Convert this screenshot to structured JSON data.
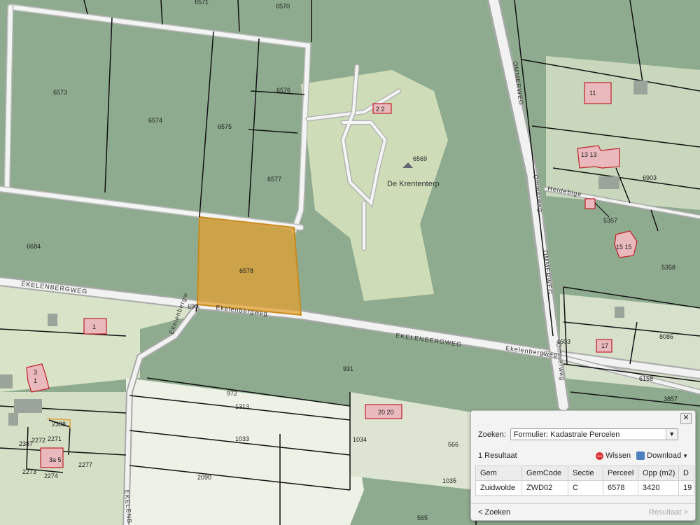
{
  "map": {
    "parcels": [
      "6571",
      "6570",
      "6573",
      "6574",
      "6575",
      "6576",
      "6577",
      "6569",
      "6684",
      "6578",
      "690",
      "931",
      "972",
      "1313",
      "1033",
      "1034",
      "2090",
      "2388",
      "2387",
      "2272",
      "2271",
      "2273",
      "2274",
      "2277",
      "566",
      "1035",
      "565",
      "6903",
      "5357",
      "5358",
      "4603",
      "8086",
      "6158",
      "3857"
    ],
    "houses": [
      "2 2",
      "11",
      "13 13",
      "15 15",
      "17",
      "1",
      "3",
      "20 20",
      "1",
      "3a 5"
    ],
    "place_name": "De Krententerp",
    "roads": [
      "OMMERWEG",
      "Ommerweg",
      "OMMERWEG",
      "Ommerweg",
      "EKELENBERGWEG",
      "Ekelenbergweg",
      "EKELENBERGWEG",
      "Ekelenbergweg",
      "Ekelenbergw",
      "EKELENB",
      "Heidebige"
    ],
    "highlight_color": "#e0a030"
  },
  "panel": {
    "search_label": "Zoeken:",
    "search_value": "Formulier: Kadastrale Percelen",
    "result_count": "1 Resultaat",
    "wissen_label": "Wissen",
    "download_label": "Download",
    "columns": [
      "Gem",
      "GemCode",
      "Sectie",
      "Perceel",
      "Opp (m2)",
      "D"
    ],
    "row": [
      "Zuidwolde",
      "ZWD02",
      "C",
      "6578",
      "3420",
      "19"
    ],
    "back_label": "< Zoeken",
    "next_label": "Resultaat >",
    "close_symbol": "✕"
  }
}
